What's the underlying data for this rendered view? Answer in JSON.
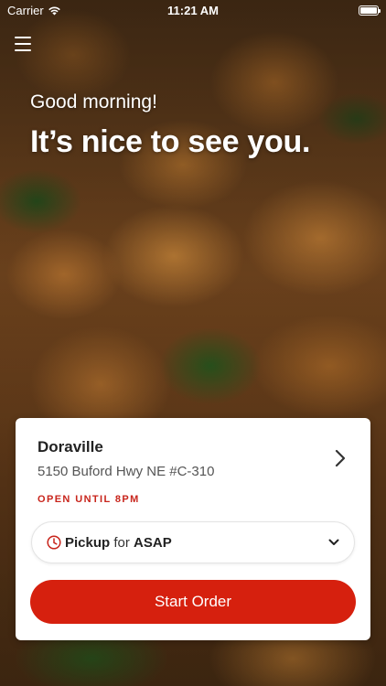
{
  "status_bar": {
    "carrier": "Carrier",
    "time": "11:21 AM"
  },
  "greeting": {
    "subtitle": "Good morning!",
    "title": "It’s nice to see you."
  },
  "location": {
    "name": "Doraville",
    "address": "5150 Buford Hwy NE #C-310",
    "status": "OPEN UNTIL 8PM"
  },
  "order": {
    "method": "Pickup",
    "connector": "for",
    "time": "ASAP"
  },
  "actions": {
    "start_order": "Start Order"
  },
  "colors": {
    "accent": "#d6200e",
    "status_red": "#c8251c"
  }
}
